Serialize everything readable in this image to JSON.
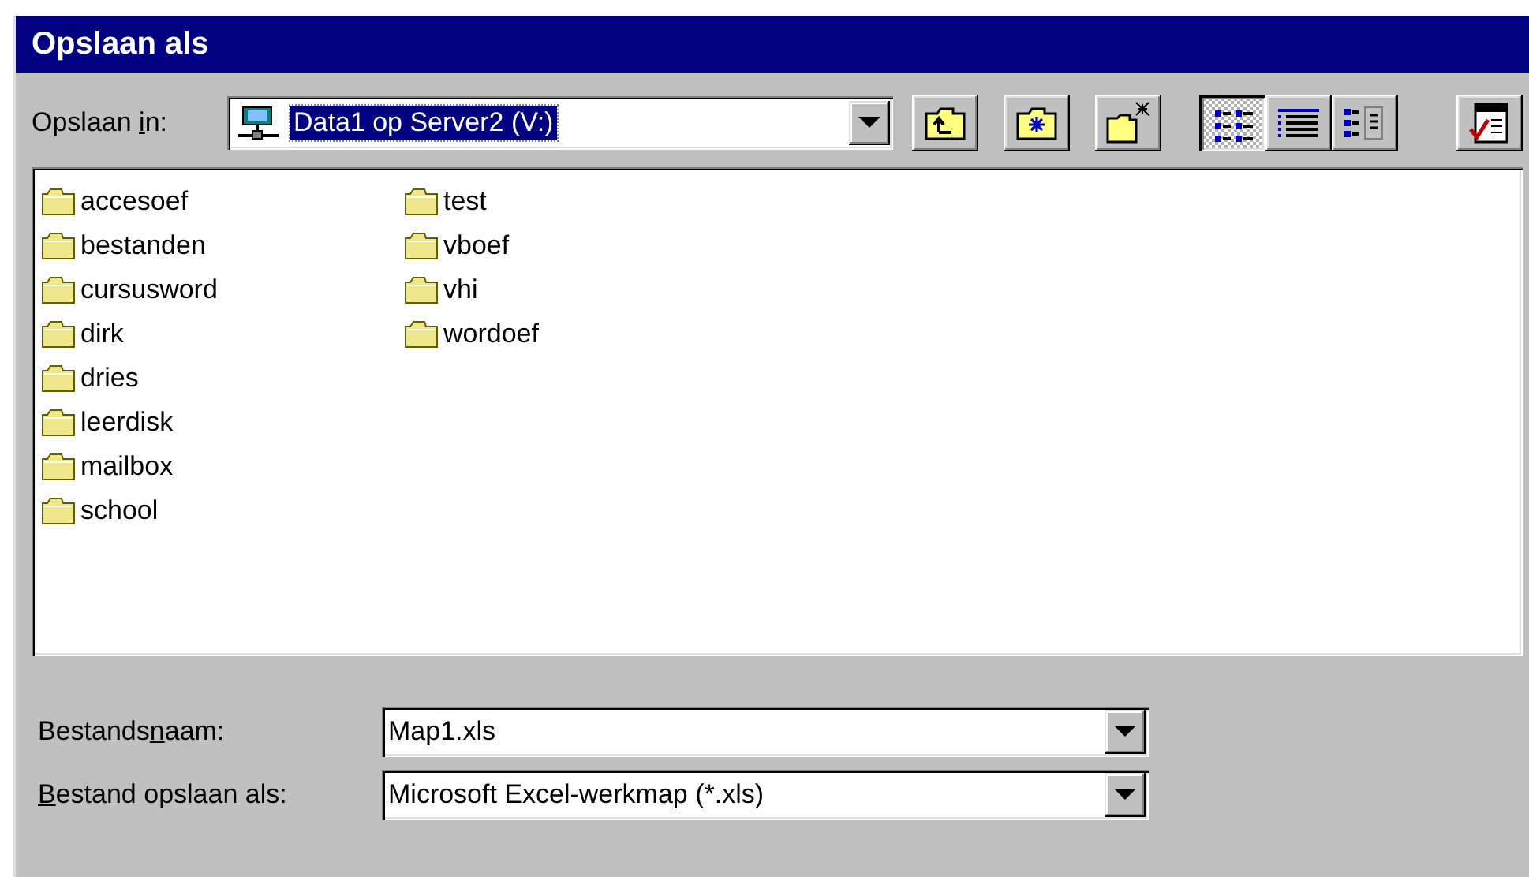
{
  "window": {
    "title": "Opslaan als"
  },
  "save_in": {
    "label": {
      "before": "Opslaan ",
      "key": "i",
      "after": "n:"
    },
    "value": "Data1 op Server2 (V:)"
  },
  "toolbar": [
    {
      "kind": "up-folder"
    },
    {
      "kind": "favorites"
    },
    {
      "kind": "new-folder"
    }
  ],
  "view_buttons": [
    {
      "kind": "list",
      "selected": true
    },
    {
      "kind": "details",
      "selected": false
    },
    {
      "kind": "properties",
      "selected": false
    }
  ],
  "tools": [
    {
      "kind": "commands"
    }
  ],
  "folders": [
    "accesoef",
    "bestanden",
    "cursusword",
    "dirk",
    "dries",
    "leerdisk",
    "mailbox",
    "school",
    "test",
    "vboef",
    "vhi",
    "wordoef"
  ],
  "fields": [
    {
      "label": {
        "before": "Bestands",
        "key": "n",
        "after": "aam:"
      },
      "value": "Map1.xls"
    },
    {
      "label": {
        "key": "B",
        "after": "estand opslaan als:"
      },
      "value": "Microsoft Excel-werkmap (*.xls)"
    }
  ]
}
